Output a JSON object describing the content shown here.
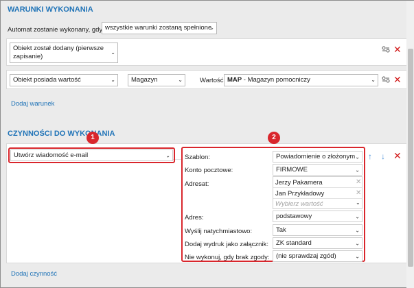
{
  "conditions": {
    "title": "WARUNKI WYKONANIA",
    "automat_label": "Automat zostanie wykonany, gdy",
    "automat_select": "wszystkie warunki zostaną spełnione",
    "rows": [
      {
        "condition": "Obiekt został dodany (pierwsze zapisanie)"
      },
      {
        "condition": "Obiekt posiada wartość",
        "field": "Magazyn",
        "value_label": "Wartość:",
        "value_code": "MAP",
        "value_name": " - Magazyn pomocniczy"
      }
    ],
    "add_link": "Dodaj warunek"
  },
  "actions": {
    "title": "CZYNNOŚCI DO WYKONANIA",
    "action_select": "Utwórz wiadomość e-mail",
    "badge1": "1",
    "badge2": "2",
    "params": {
      "szablon_label": "Szablon:",
      "szablon_value": "Powiadomienie o złożonym",
      "konto_label": "Konto pocztowe:",
      "konto_value": "FIRMOWE",
      "adresat_label": "Adresat:",
      "adresat_items": [
        "Jerzy Pakamera",
        "Jan Przykładowy"
      ],
      "adresat_placeholder": "Wybierz wartość",
      "adres_label": "Adres:",
      "adres_value": "podstawowy",
      "wyslij_label": "Wyślij natychmiastowo:",
      "wyslij_value": "Tak",
      "wydruk_label": "Dodaj wydruk jako załącznik:",
      "wydruk_value": "ZK standard",
      "zgoda_label": "Nie wykonuj, gdy brak zgody:",
      "zgoda_value": "(nie sprawdzaj zgód)"
    },
    "add_link": "Dodaj czynność"
  },
  "icons": {
    "delete": "✕",
    "move_up": "↑",
    "move_down": "↓",
    "chevron": "⌄",
    "chip_remove": "✕"
  },
  "colors": {
    "accent": "#1f73b7",
    "danger": "#d32020",
    "highlight": "#d9262c"
  }
}
